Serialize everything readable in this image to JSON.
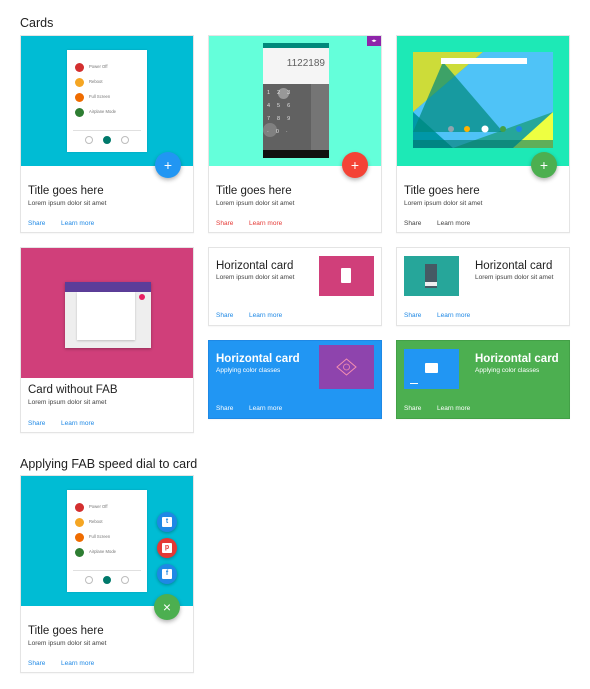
{
  "sections": {
    "cards_title": "Cards",
    "fab_dial_title": "Applying FAB speed dial to card"
  },
  "colors": {
    "cyan": "#00bcd4",
    "mint": "#64ffda",
    "teal": "#1de9b6",
    "pink": "#d03f7a",
    "blue": "#2196f3",
    "green": "#4caf50",
    "red_fab": "#f44336",
    "link_blue": "#1e88e5",
    "link_red": "#e53935"
  },
  "power_menu": {
    "items": [
      "Power Off",
      "Reboot",
      "Full Screen",
      "Airplane Mode"
    ]
  },
  "dialer": {
    "number": "1122189"
  },
  "card1": {
    "title": "Title goes here",
    "subtitle": "Lorem ipsum dolor sit amet",
    "share": "Share",
    "learn": "Learn more",
    "fab": "+"
  },
  "card2": {
    "title": "Title goes here",
    "subtitle": "Lorem ipsum dolor sit amet",
    "share": "Share",
    "learn": "Learn more",
    "fab": "+"
  },
  "card3": {
    "title": "Title goes here",
    "subtitle": "Lorem ipsum dolor sit amet",
    "share": "Share",
    "learn": "Learn more",
    "fab": "+"
  },
  "card4": {
    "title": "Card without FAB",
    "subtitle": "Lorem ipsum dolor sit amet",
    "share": "Share",
    "learn": "Learn more"
  },
  "hcard1": {
    "title": "Horizontal card",
    "subtitle": "Lorem ipsum dolor sit amet",
    "share": "Share",
    "learn": "Learn more"
  },
  "hcard2": {
    "title": "Horizontal card",
    "subtitle": "Lorem ipsum dolor sit amet",
    "share": "Share",
    "learn": "Learn more"
  },
  "hcard3": {
    "title": "Horizontal card",
    "subtitle": "Applying color classes",
    "share": "Share",
    "learn": "Learn more"
  },
  "hcard4": {
    "title": "Horizontal card",
    "subtitle": "Applying color classes",
    "share": "Share",
    "learn": "Learn more"
  },
  "dialcard": {
    "title": "Title goes here",
    "subtitle": "Lorem ipsum dolor sit amet",
    "share": "Share",
    "learn": "Learn more",
    "fab": "×"
  }
}
